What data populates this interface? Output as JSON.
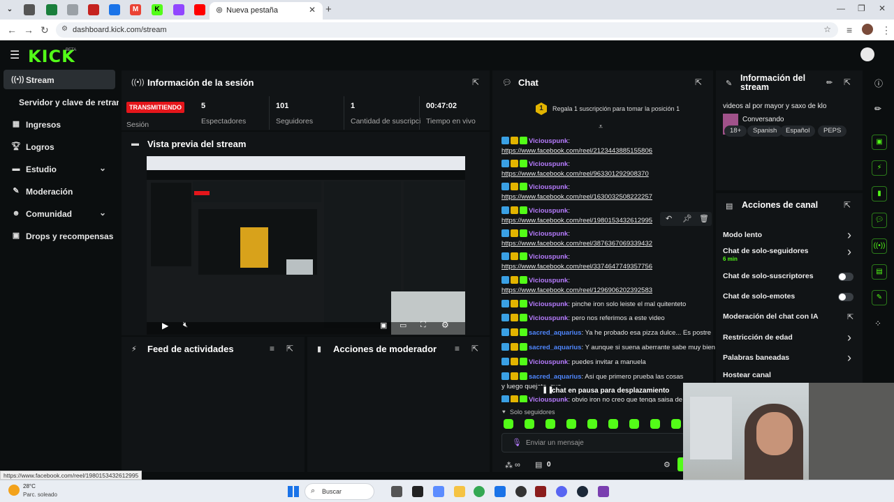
{
  "browser": {
    "tab_title": "Nueva pestaña",
    "url": "dashboard.kick.com/stream"
  },
  "kick": {
    "logo": "KICK",
    "beta": "BETA"
  },
  "sidebar": {
    "items": [
      {
        "label": "Stream",
        "icon": "stream-icon"
      },
      {
        "label": "Servidor y clave de retransmisión"
      },
      {
        "label": "Ingresos",
        "icon": "income-icon"
      },
      {
        "label": "Logros",
        "icon": "trophy-icon"
      },
      {
        "label": "Estudio",
        "icon": "studio-icon"
      },
      {
        "label": "Moderación",
        "icon": "wrench-icon"
      },
      {
        "label": "Comunidad",
        "icon": "community-icon"
      },
      {
        "label": "Drops y recompensas",
        "icon": "gift-icon"
      }
    ]
  },
  "session": {
    "title": "Información de la sesión",
    "live_badge": "TRANSMITIENDO",
    "session_label": "Sesión",
    "stats": [
      {
        "value": "5",
        "label": "Espectadores"
      },
      {
        "value": "101",
        "label": "Seguidores"
      },
      {
        "value": "1",
        "label": "Cantidad de suscripciones"
      },
      {
        "value": "00:47:02",
        "label": "Tiempo en vivo"
      }
    ]
  },
  "preview": {
    "title": "Vista previa del stream"
  },
  "feed": {
    "title": "Feed de actividades"
  },
  "modactions": {
    "title": "Acciones de moderador"
  },
  "chat": {
    "title": "Chat",
    "gift_prompt": "Regala 1 suscripción para tomar la posición 1",
    "gift_rank": "1",
    "messages": [
      {
        "user": "Viciouspunk",
        "text": "https://www.facebook.com/reel/2123443885155806",
        "link": true
      },
      {
        "user": "Viciouspunk",
        "text": "https://www.facebook.com/reel/963301292908370",
        "link": true
      },
      {
        "user": "Viciouspunk",
        "text": "https://www.facebook.com/reel/1630032508222257",
        "link": true
      },
      {
        "user": "Viciouspunk",
        "text": "https://www.facebook.com/reel/1980153432612995",
        "link": true
      },
      {
        "user": "Viciouspunk",
        "text": "https://www.facebook.com/reel/3876367069339432",
        "link": true
      },
      {
        "user": "Viciouspunk",
        "text": "https://www.facebook.com/reel/3374647749357756",
        "link": true
      },
      {
        "user": "Viciouspunk",
        "text": "https://www.facebook.com/reel/1296906202392583",
        "link": true
      },
      {
        "user": "Viciouspunk",
        "text": "pinche iron solo leiste el mal quitenteto"
      },
      {
        "user": "Viciouspunk",
        "text": "pero nos referimos a este video"
      },
      {
        "user": "sacred_aquarius",
        "text": "Ya he probado esa pizza dulce... Es postre"
      },
      {
        "user": "sacred_aquarius",
        "text": "Y aunque si suena aberrante sabe muy bien"
      },
      {
        "user": "Viciouspunk",
        "text": "puedes invitar a manuela"
      },
      {
        "user": "sacred_aquarius",
        "text": "Asi que primero prueba las cosas y luego quejate, que"
      },
      {
        "user": "Viciouspunk",
        "text": "obvio iron no creo que tenga saisa de"
      }
    ],
    "paused": "chat en pausa para desplazamiento",
    "followers_only": "Solo seguidores",
    "input_placeholder": "Enviar un mensaje",
    "points": "0"
  },
  "stream_info": {
    "title": "Información del stream",
    "stream_title": "videos al por mayor y saxo de klo",
    "category": "Conversando",
    "tags": [
      "18+",
      "Spanish",
      "Español",
      "PEPS"
    ]
  },
  "channel_actions": {
    "title": "Acciones de canal",
    "rows": [
      {
        "label": "Modo lento",
        "control": "chevron"
      },
      {
        "label": "Chat de solo-seguidores",
        "sub": "6 min",
        "control": "chevron"
      },
      {
        "label": "Chat de solo-suscriptores",
        "control": "toggle"
      },
      {
        "label": "Chat de solo-emotes",
        "control": "toggle"
      },
      {
        "label": "Moderación del chat con IA",
        "control": "external"
      },
      {
        "label": "Restricción de edad",
        "control": "chevron"
      },
      {
        "label": "Palabras baneadas",
        "control": "chevron"
      },
      {
        "label": "Hostear canal",
        "control": "none"
      }
    ]
  },
  "taskbar": {
    "weather_temp": "28°C",
    "weather_desc": "Parc. soleado",
    "search_placeholder": "Buscar"
  },
  "status_url": "https://www.facebook.com/reel/1980153432612995",
  "colors": {
    "accent": "#53fc18",
    "live": "#e5161b",
    "bg": "#0b0e0f",
    "panel": "#111416"
  }
}
